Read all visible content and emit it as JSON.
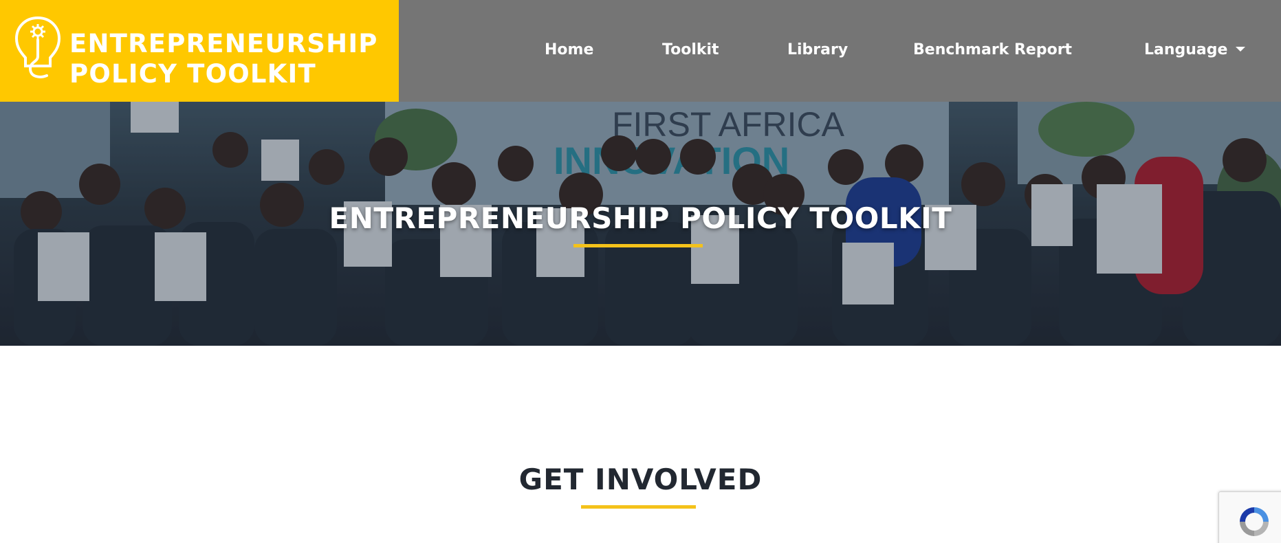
{
  "brand": {
    "line1": "ENTREPRENEURSHIP",
    "line2": "POLICY TOOLKIT",
    "logo_icon": "lightbulb-gear-icon",
    "accent_color": "#ffc800",
    "header_color": "#757575"
  },
  "nav": {
    "items": [
      {
        "label": "Home"
      },
      {
        "label": "Toolkit"
      },
      {
        "label": "Library"
      },
      {
        "label": "Benchmark Report"
      },
      {
        "label": "Language"
      }
    ],
    "dropdown_icon": "caret-down-icon"
  },
  "hero": {
    "title": "ENTREPRENEURSHIP POLICY TOOLKIT",
    "banner_text_line1": "FIRST AFRICA",
    "banner_text_line2": "INNOVATION",
    "underline_color": "#f4c21a"
  },
  "section": {
    "title": "GET INVOLVED"
  },
  "recaptcha": {
    "icon": "recaptcha-icon"
  }
}
